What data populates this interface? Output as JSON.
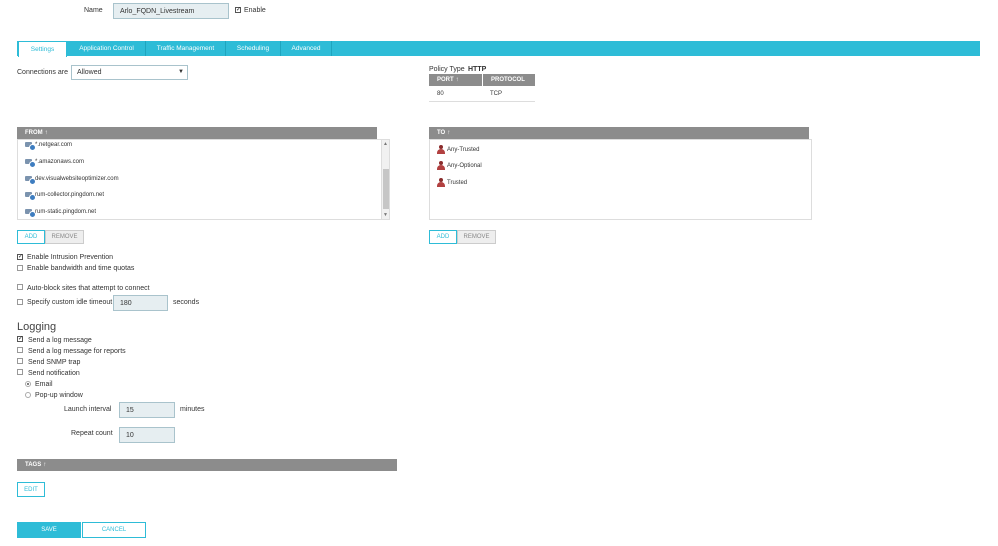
{
  "header": {
    "name_label": "Name",
    "name_value": "Arlo_FQDN_Livestream",
    "enable_label": "Enable"
  },
  "tabs": [
    {
      "label": "Settings",
      "active": true
    },
    {
      "label": "Application Control",
      "active": false
    },
    {
      "label": "Traffic Management",
      "active": false
    },
    {
      "label": "Scheduling",
      "active": false
    },
    {
      "label": "Advanced",
      "active": false
    }
  ],
  "connections": {
    "label": "Connections are",
    "value": "Allowed"
  },
  "policy": {
    "type_label": "Policy Type",
    "type_value": "HTTP",
    "columns": [
      "PORT",
      "PROTOCOL"
    ],
    "rows": [
      [
        "80",
        "TCP"
      ]
    ]
  },
  "from": {
    "header": "FROM",
    "items": [
      "*.netgear.com",
      "*.amazonaws.com",
      "dev.visualwebsiteoptimizer.com",
      "rum-collector.pingdom.net",
      "rum-static.pingdom.net"
    ],
    "add_label": "ADD",
    "remove_label": "REMOVE"
  },
  "to": {
    "header": "TO",
    "items": [
      "Any-Trusted",
      "Any-Optional",
      "Trusted"
    ],
    "add_label": "ADD",
    "remove_label": "REMOVE"
  },
  "options": {
    "intrusion_prevention": "Enable Intrusion Prevention",
    "bandwidth_quotas": "Enable bandwidth and time quotas",
    "auto_block": "Auto-block sites that attempt to connect",
    "idle_timeout": "Specify custom idle timeout",
    "idle_timeout_value": "180",
    "idle_timeout_unit": "seconds"
  },
  "logging": {
    "title": "Logging",
    "send_log": "Send a log message",
    "send_log_reports": "Send a log message for reports",
    "snmp_trap": "Send SNMP trap",
    "send_notification": "Send notification",
    "email": "Email",
    "popup": "Pop-up window",
    "launch_interval_label": "Launch interval",
    "launch_interval_value": "15",
    "launch_interval_unit": "minutes",
    "repeat_count_label": "Repeat count",
    "repeat_count_value": "10"
  },
  "tags": {
    "header": "TAGS",
    "edit_label": "EDIT"
  },
  "footer": {
    "save_label": "SAVE",
    "cancel_label": "CANCEL"
  },
  "colors": {
    "accent": "#2ebcd7",
    "grid_header": "#8c8c8c"
  }
}
